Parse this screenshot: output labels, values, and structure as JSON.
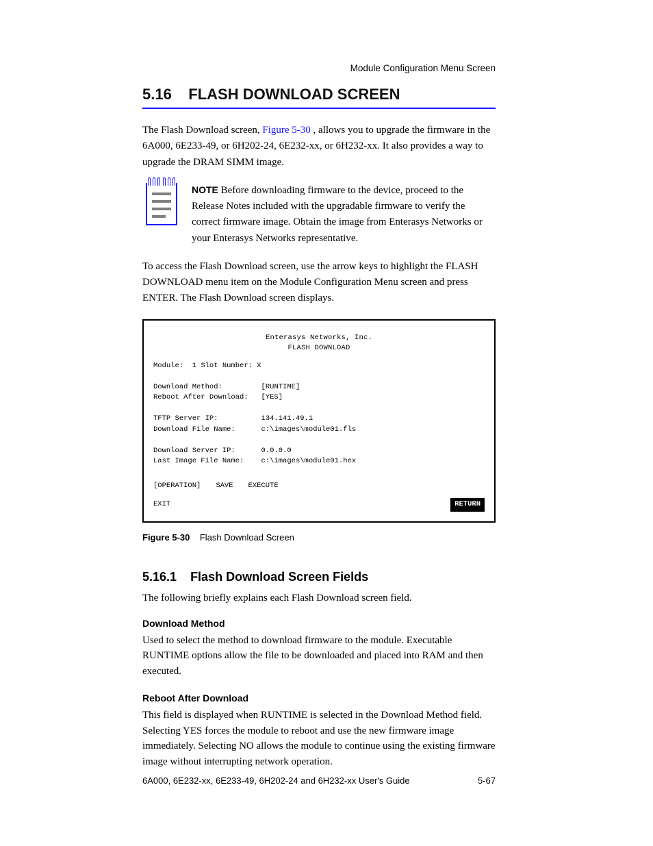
{
  "header": {
    "right": "Module Configuration Menu Screen"
  },
  "section": {
    "number": "5.16",
    "title": "FLASH DOWNLOAD SCREEN",
    "intro": "The Flash Download screen, ",
    "fig_ref": "Figure 5-30",
    "intro_tail": ", allows you to upgrade the firmware in the 6A000, 6E233-49, or 6H202-24, 6E232-xx, or 6H232-xx. It also provides a way to upgrade the DRAM SIMM image."
  },
  "note": {
    "label": "NOTE",
    "text": "Before downloading firmware to the device, proceed to the Release Notes included with the upgradable firmware to verify the correct firmware image. Obtain the image from Enterasys Networks or your Enterasys Networks representative."
  },
  "access_para": "To access the Flash Download screen, use the arrow keys to highlight the FLASH DOWNLOAD menu item on the Module Configuration Menu screen and press ENTER. The Flash Download screen displays.",
  "screen": {
    "company": "Enterasys Networks, Inc.",
    "title_text": "FLASH DOWNLOAD",
    "label_module": "Module:",
    "module_slot": "1    Slot Number:  X",
    "label_method": "Download Method:",
    "value_method": "[RUNTIME]",
    "label_reboot": "Reboot After Download:",
    "value_reboot": "[YES]",
    "label_server": "TFTP Server IP:",
    "value_server": "134.141.49.1",
    "label_filename": "Download File Name:",
    "value_filename": "c:\\images\\module01.fls",
    "label_serial": "Download Server IP:",
    "value_serial": "0.0.0.0",
    "label_lastfile": "Last Image File Name:",
    "value_lastfile": "c:\\images\\module01.hex",
    "menu": [
      "[OPERATION]",
      "SAVE",
      "EXECUTE"
    ],
    "exit": "EXIT",
    "highlighted": "RETURN"
  },
  "caption": {
    "lead": "Figure 5-30",
    "text": "Flash Download Screen"
  },
  "subsection": {
    "number": "5.16.1",
    "title": "Flash Download Screen Fields",
    "intro": "The following briefly explains each Flash Download screen field."
  },
  "fields": [
    {
      "name": "Download Method",
      "desc": "Used to select the method to download firmware to the module. Executable RUNTIME options allow the file to be downloaded and placed into RAM and then executed."
    },
    {
      "name": "Reboot After Download",
      "desc": "This field is displayed when RUNTIME is selected in the Download Method field. Selecting YES forces the module to reboot and use the new firmware image immediately. Selecting NO allows the module to continue using the existing firmware image without interrupting network operation."
    }
  ],
  "footer": {
    "left": "6A000, 6E232-xx, 6E233-49, 6H202-24 and 6H232-xx User's Guide",
    "right": "5-67"
  }
}
